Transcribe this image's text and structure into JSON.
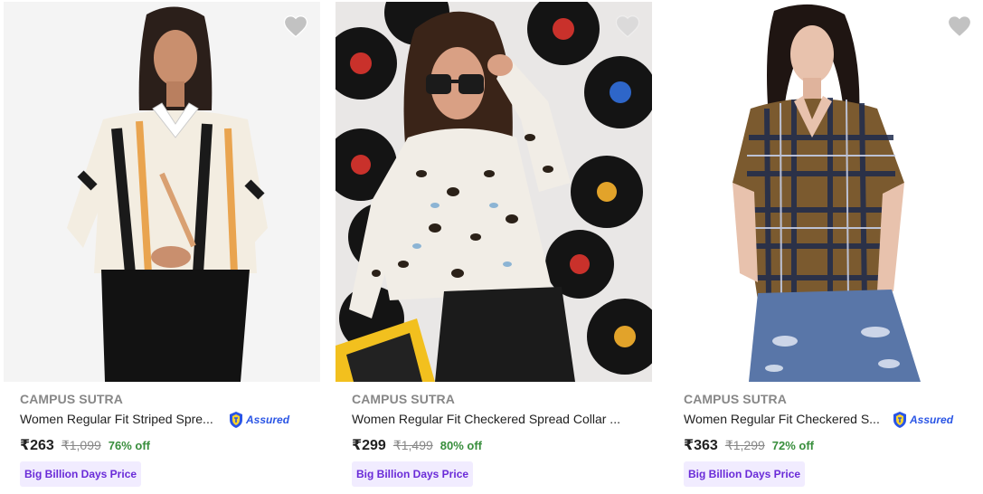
{
  "colors": {
    "brand_text": "#878787",
    "title_text": "#212121",
    "discount_green": "#388e3c",
    "assured_blue": "#2a55e5",
    "badge_bg": "#f1ecff",
    "badge_text": "#6a2bd8",
    "wishlist_heart": "#c2c2c2"
  },
  "products": [
    {
      "brand": "CAMPUS SUTRA",
      "title": "Women Regular Fit Striped Spre...",
      "assured": "Assured",
      "price": "₹263",
      "mrp": "₹1,099",
      "discount": "76% off",
      "badge": "Big Billion Days Price",
      "wishlist_icon": "heart-icon",
      "image": "woman in striped black-white-orange shirt and black trousers"
    },
    {
      "brand": "CAMPUS SUTRA",
      "title": "Women Regular Fit Checkered Spread Collar ...",
      "assured": "",
      "price": "₹299",
      "mrp": "₹1,499",
      "discount": "80% off",
      "badge": "Big Billion Days Price",
      "wishlist_icon": "heart-icon",
      "image": "woman in leopard print tied shirt with sunglasses, vinyl records background"
    },
    {
      "brand": "CAMPUS SUTRA",
      "title": "Women Regular Fit Checkered S...",
      "assured": "Assured",
      "price": "₹363",
      "mrp": "₹1,299",
      "discount": "72% off",
      "badge": "Big Billion Days Price",
      "wishlist_icon": "heart-icon",
      "image": "woman in brown and navy checkered shirt with ripped jeans"
    }
  ]
}
